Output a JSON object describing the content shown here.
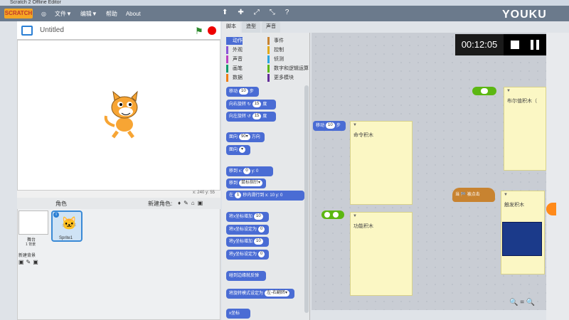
{
  "window": {
    "title": "Scratch 2 Offline Editor"
  },
  "menu": {
    "logo": "SCRATCH",
    "items": [
      "文件▼",
      "编辑▼",
      "帮助",
      "About"
    ]
  },
  "toolbar_icons": [
    "⬆",
    "✚",
    "⤢",
    "⤡",
    "?"
  ],
  "project": {
    "title": "Untitled"
  },
  "stage": {
    "coords": "x: 240  y: 55"
  },
  "sprites_panel": {
    "header": "角色",
    "new_sprite": "新建角色:",
    "stage_label": "舞台",
    "stage_sub": "1 背景",
    "new_backdrop": "新建背景",
    "sprite_name": "Sprite1"
  },
  "tabs": [
    "脚本",
    "造型",
    "声音"
  ],
  "categories": [
    {
      "label": "动作",
      "color": "#4a6cd4"
    },
    {
      "label": "事件",
      "color": "#c88330"
    },
    {
      "label": "外观",
      "color": "#8a55d7"
    },
    {
      "label": "控制",
      "color": "#e1a91a"
    },
    {
      "label": "声音",
      "color": "#bb42c3"
    },
    {
      "label": "侦测",
      "color": "#2ca5e2"
    },
    {
      "label": "画笔",
      "color": "#0e9a6c"
    },
    {
      "label": "数字和逻辑运算",
      "color": "#5cb712"
    },
    {
      "label": "数据",
      "color": "#ee7d16"
    },
    {
      "label": "更多模块",
      "color": "#632d99"
    }
  ],
  "blocks": [
    {
      "pre": "移动",
      "slot": "10",
      "post": "步"
    },
    {
      "pre": "向右旋转 ↻",
      "slot": "15",
      "post": "度"
    },
    {
      "pre": "向左旋转 ↺",
      "slot": "15",
      "post": "度"
    },
    {
      "pre": "面向",
      "slot": "90▾",
      "post": "方向"
    },
    {
      "pre": "面向",
      "slot": "▾",
      "post": ""
    },
    {
      "pre": "移到 x:",
      "slot": "0",
      "post": "y: 0"
    },
    {
      "pre": "移到",
      "slot": "鼠标指针▾",
      "post": ""
    },
    {
      "pre": "在",
      "slot": "1",
      "post": "秒内滑行到 x: 10 y: 0"
    },
    {
      "pre": "将x坐标增加",
      "slot": "10",
      "post": ""
    },
    {
      "pre": "将x坐标设定为",
      "slot": "0",
      "post": ""
    },
    {
      "pre": "将y坐标增加",
      "slot": "10",
      "post": ""
    },
    {
      "pre": "将y坐标设定为",
      "slot": "0",
      "post": ""
    },
    {
      "pre": "碰到边缘就反弹",
      "slot": "",
      "post": ""
    },
    {
      "pre": "将旋转模式设定为",
      "slot": "左-右翻转▾",
      "post": ""
    },
    {
      "pre": "x坐标",
      "slot": "",
      "post": ""
    }
  ],
  "script_area": {
    "move_block": {
      "pre": "移动",
      "slot": "10",
      "post": "步"
    },
    "note_command": "命令积木",
    "note_function": "功能积木",
    "note_boolean": "布尔值积木（",
    "note_trigger": "触发积木",
    "hat_block": "当 🏁 被点击"
  },
  "video": {
    "time": "00:12:05",
    "brand": "YOUKU"
  },
  "zoom": "🔍 = 🔍"
}
